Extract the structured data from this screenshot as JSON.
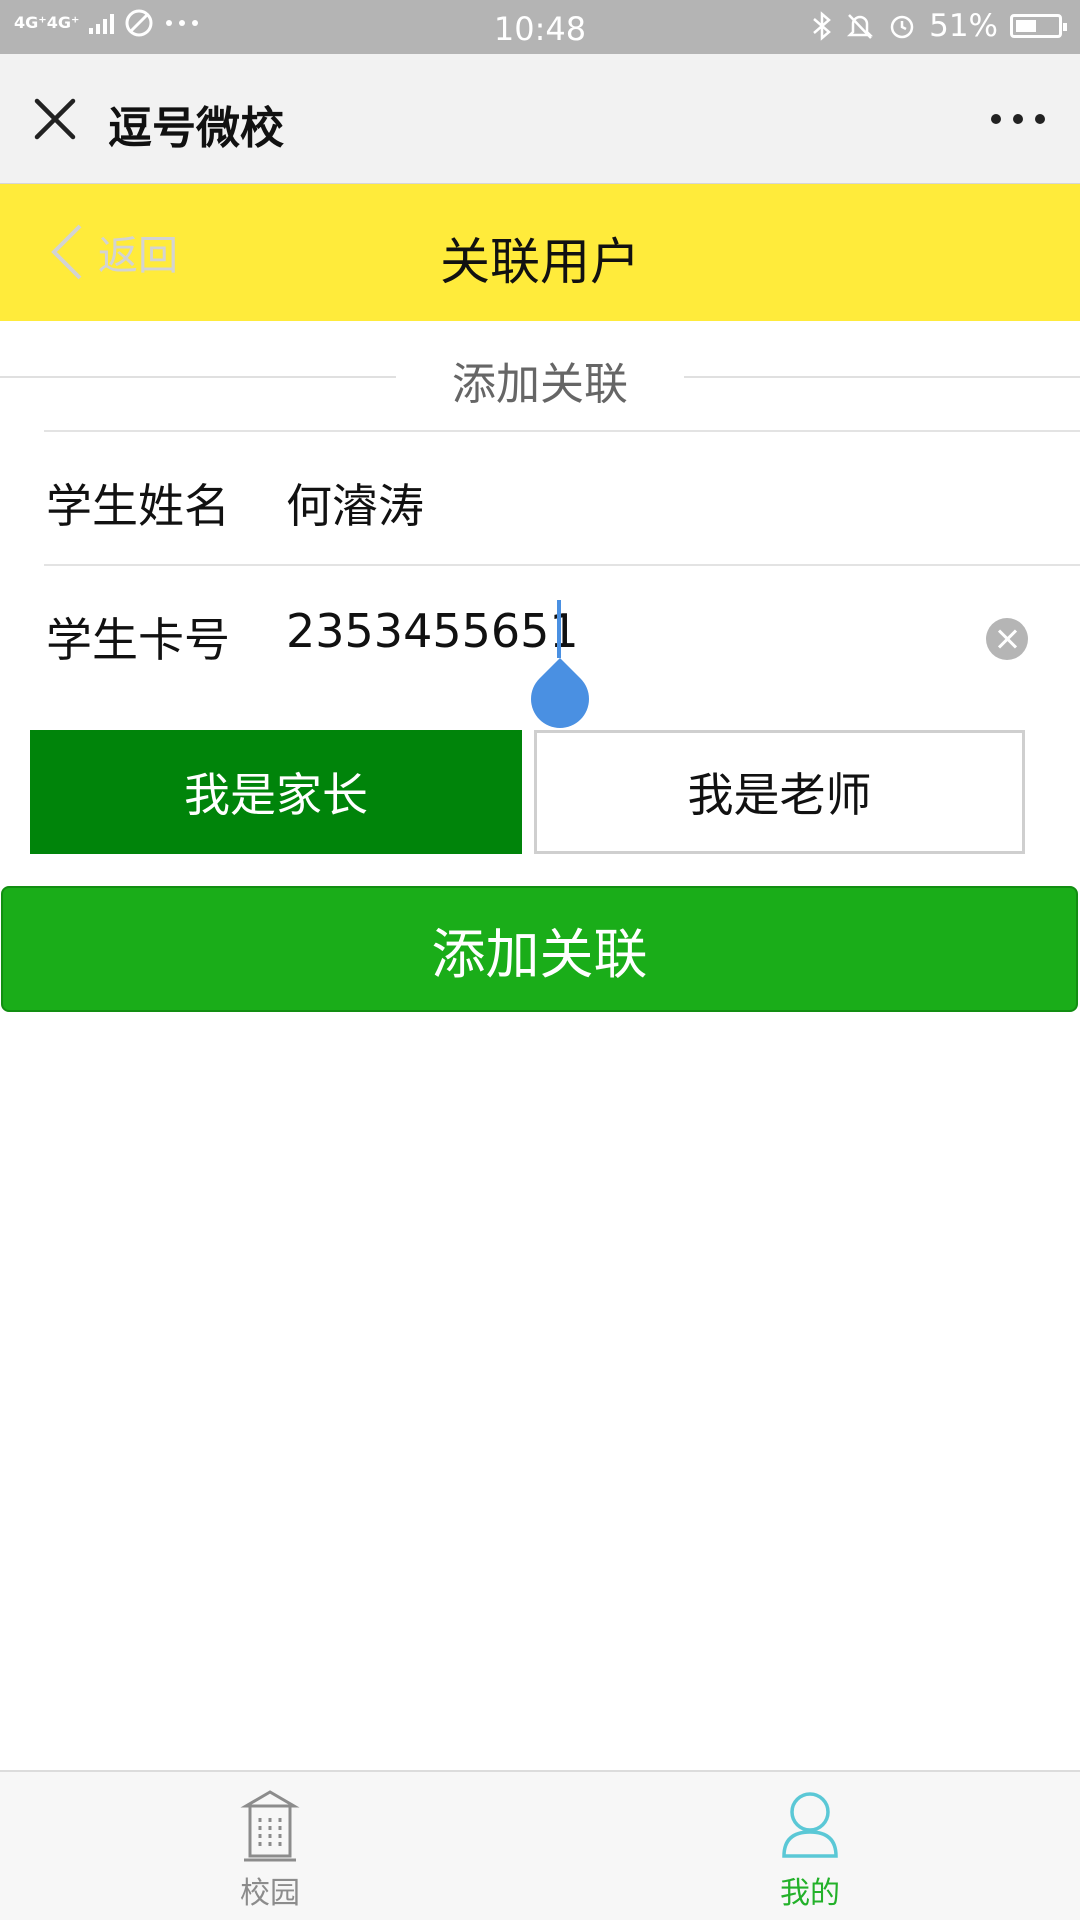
{
  "status_bar": {
    "network": "4G⁺4G⁺",
    "time": "10:48",
    "battery": "51%",
    "battery_level": 0.51
  },
  "titlebar": {
    "app_title": "逗号微校",
    "close_icon": "close-icon",
    "more_icon": "more-dots-icon"
  },
  "header": {
    "back_label": "返回",
    "title": "关联用户",
    "background": "#ffeb3b"
  },
  "section": {
    "title": "添加关联"
  },
  "form": {
    "name": {
      "label": "学生姓名",
      "value": "何濬涛"
    },
    "card": {
      "label": "学生卡号",
      "value": "2353455651"
    }
  },
  "roles": {
    "parent_label": "我是家长",
    "teacher_label": "我是老师",
    "selected": "parent",
    "selected_color": "#00840a"
  },
  "actions": {
    "add_label": "添加关联",
    "add_color": "#1aad19"
  },
  "tabbar": {
    "campus_label": "校园",
    "mine_label": "我的",
    "active": "mine",
    "active_color": "#23b12a"
  }
}
